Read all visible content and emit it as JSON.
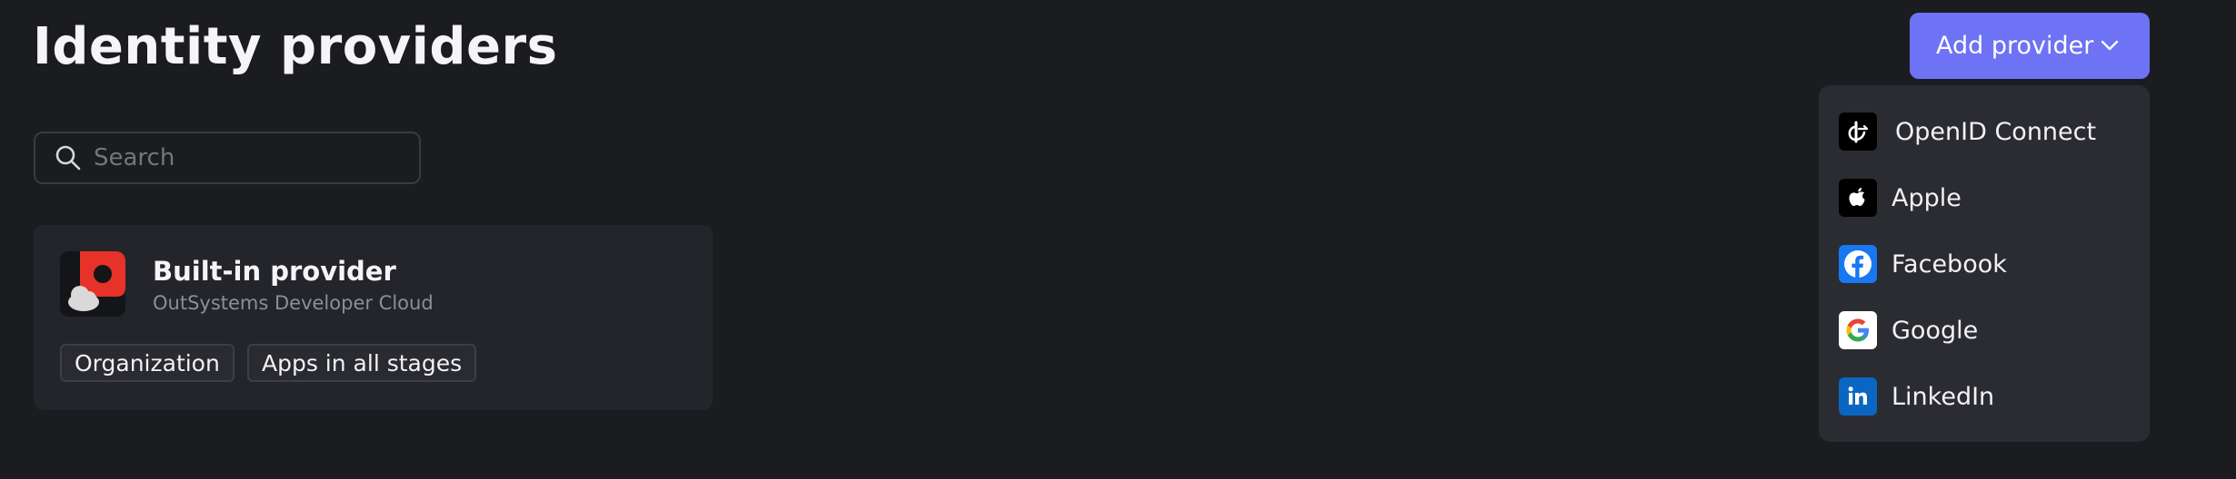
{
  "page": {
    "title": "Identity providers"
  },
  "search": {
    "placeholder": "Search",
    "value": ""
  },
  "providers": [
    {
      "name": "Built-in provider",
      "subtitle": "OutSystems Developer Cloud",
      "tags": [
        "Organization",
        "Apps in all stages"
      ],
      "icon": "outsystems-cloud-logo"
    }
  ],
  "add_provider": {
    "label": "Add provider",
    "icon": "chevron-down-icon",
    "menu": [
      {
        "label": "OpenID Connect",
        "icon": "openid-icon"
      },
      {
        "label": "Apple",
        "icon": "apple-icon"
      },
      {
        "label": "Facebook",
        "icon": "facebook-icon"
      },
      {
        "label": "Google",
        "icon": "google-icon"
      },
      {
        "label": "LinkedIn",
        "icon": "linkedin-icon"
      }
    ]
  },
  "colors": {
    "background": "#1b1c20",
    "card": "#24252a",
    "menu": "#2b2c32",
    "accent": "#6e72f4",
    "facebook": "#1877f2",
    "linkedin": "#0a66c2",
    "brand_red": "#e63228"
  }
}
